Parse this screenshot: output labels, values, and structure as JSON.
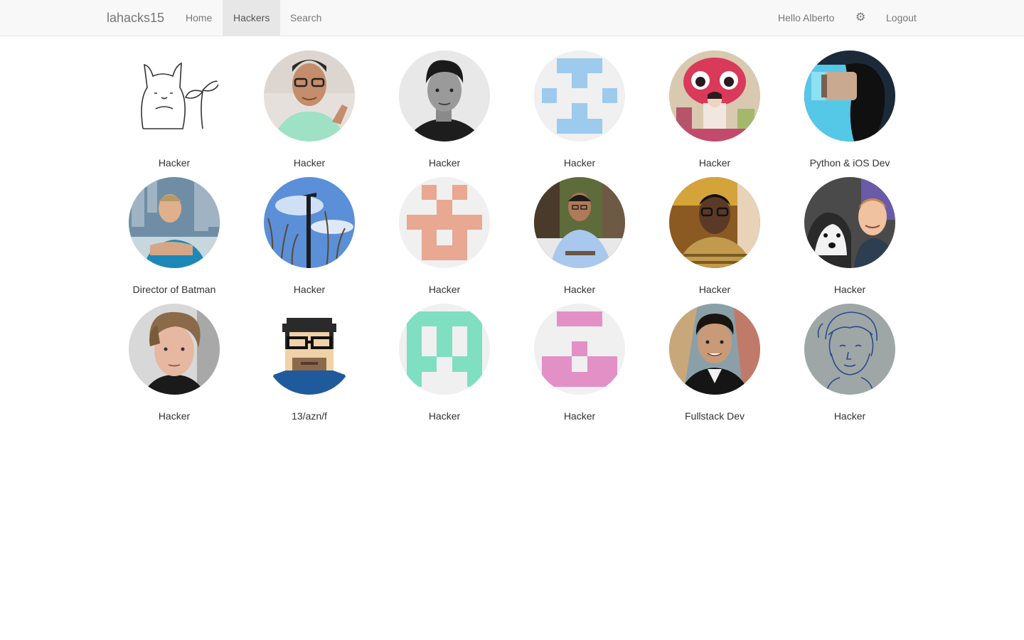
{
  "navbar": {
    "brand": "lahacks15",
    "home_label": "Home",
    "hackers_label": "Hackers",
    "search_label": "Search",
    "greeting": "Hello Alberto",
    "settings_icon": "gear-icon",
    "logout_label": "Logout",
    "active_tab": "Hackers"
  },
  "hackers": [
    {
      "title": "Hacker",
      "avatar": "sketch-totoro"
    },
    {
      "title": "Hacker",
      "avatar": "photo"
    },
    {
      "title": "Hacker",
      "avatar": "photo-bw"
    },
    {
      "title": "Hacker",
      "avatar": "identicon-blue",
      "color": "#9ccbed"
    },
    {
      "title": "Hacker",
      "avatar": "illustration"
    },
    {
      "title": "Python & iOS Dev",
      "avatar": "photo-vr"
    },
    {
      "title": "Director of Batman",
      "avatar": "photo"
    },
    {
      "title": "Hacker",
      "avatar": "photo-sky"
    },
    {
      "title": "Hacker",
      "avatar": "identicon-salmon",
      "color": "#e8a891"
    },
    {
      "title": "Hacker",
      "avatar": "photo"
    },
    {
      "title": "Hacker",
      "avatar": "photo"
    },
    {
      "title": "Hacker",
      "avatar": "photo-dog"
    },
    {
      "title": "Hacker",
      "avatar": "photo"
    },
    {
      "title": "13/azn/f",
      "avatar": "pixel-art"
    },
    {
      "title": "Hacker",
      "avatar": "identicon-mint",
      "color": "#7fdfc0"
    },
    {
      "title": "Hacker",
      "avatar": "identicon-pink",
      "color": "#e290c6"
    },
    {
      "title": "Fullstack Dev",
      "avatar": "photo"
    },
    {
      "title": "Hacker",
      "avatar": "sketch-blue"
    }
  ]
}
